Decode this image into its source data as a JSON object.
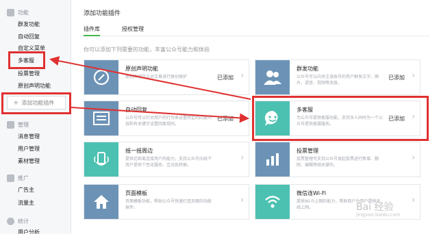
{
  "sidebar": {
    "sections": [
      {
        "title": "功能",
        "icon": "grid-icon",
        "items": [
          "群发功能",
          "自动回复",
          "自定义菜单",
          "多客服",
          "投票管理",
          "原创声明功能"
        ]
      },
      {
        "title": "管理",
        "icon": "box-icon",
        "items": [
          "消息管理",
          "用户管理",
          "素材管理"
        ]
      },
      {
        "title": "推广",
        "icon": "megaphone-icon",
        "items": [
          "广告主",
          "流量主"
        ]
      },
      {
        "title": "统计",
        "icon": "pie-icon",
        "items": [
          "用户分析"
        ]
      }
    ],
    "add_button": "添加功能插件"
  },
  "main": {
    "title": "添加功能插件",
    "tabs": [
      "插件库",
      "授权管理"
    ],
    "active_tab": 0,
    "hint": "你可以添加下列需要的功能，丰富公众号能力和体验",
    "cards": [
      {
        "name": "原创声明功能",
        "desc": "原创声明可以对文章进行原创保护",
        "status": "已添加",
        "icon": "compass-icon",
        "color": "#6c93b6"
      },
      {
        "name": "群发功能",
        "desc": "公众号可以向关注该账号的用户群发文字、图片、语音、视频等消息。",
        "status": "已添加",
        "icon": "users-icon",
        "color": "#6c93b6"
      },
      {
        "name": "自动回复",
        "desc": "公众号可以针对用户的行为来设置特定的回复内容和有关键字设置回复规则。",
        "status": "已添加",
        "icon": "list-icon",
        "color": "#6c93b6"
      },
      {
        "name": "多客服",
        "desc": "为公众号提供客服功能，支持多人同时为一个公众号提供客服服务。",
        "status": "已添加",
        "icon": "smile-chat-icon",
        "color": "#4cc1b1"
      },
      {
        "name": "摇一摇周边",
        "desc": "提供近距离连接用户的能力，支持公众号向线下用户提供个性化服务、互动及转换。",
        "status": "",
        "icon": "shake-hand-icon",
        "color": "#4cc1b1"
      },
      {
        "name": "投票管理",
        "desc": "投票管理可支持公众号发起投票进行新增、删除、编辑等相关操作。",
        "status": "",
        "icon": "bar-chart-icon",
        "color": "#6c93b6"
      },
      {
        "name": "页面模板",
        "desc": "页面模板功能，帮助公众号快速打造页面的功能插件。",
        "status": "",
        "icon": "home-icon",
        "color": "#6c93b6"
      },
      {
        "name": "微信连Wi-Fi",
        "desc": "提供Wi-Fi上网的能力，帮助商户为用户提供无线上网。",
        "status": "",
        "icon": "wifi-icon",
        "color": "#4cc1b1"
      }
    ]
  },
  "watermark": "Bai 经验",
  "watermark_sub": "jingyan.baidu.com"
}
